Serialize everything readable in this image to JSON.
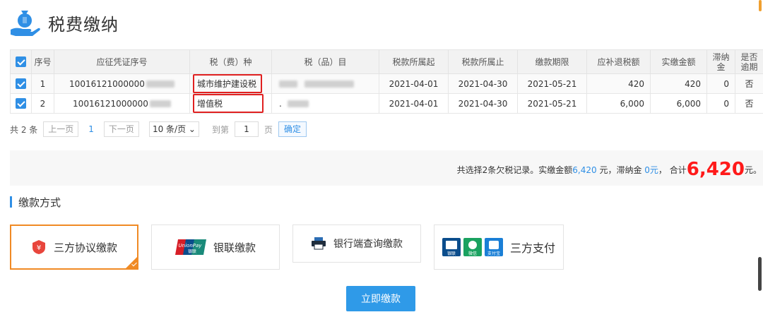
{
  "header": {
    "title": "税费缴纳"
  },
  "table": {
    "columns": [
      "序号",
      "应征凭证序号",
      "税（费）种",
      "税（品）目",
      "税款所属起",
      "税款所属止",
      "缴款期限",
      "应补退税额",
      "实缴金额",
      "滞纳金",
      "是否逾期"
    ],
    "rows": [
      {
        "index": "1",
        "voucher": "10016121000000",
        "tax_type": "城市维护建设税",
        "tax_item": "",
        "start": "2021-04-01",
        "end": "2021-04-30",
        "deadline": "2021-05-21",
        "due": "420",
        "paid": "420",
        "late_fee": "0",
        "overdue": "否"
      },
      {
        "index": "2",
        "voucher": "10016121000000",
        "tax_type": "增值税",
        "tax_item": ".",
        "start": "2021-04-01",
        "end": "2021-04-30",
        "deadline": "2021-05-21",
        "due": "6,000",
        "paid": "6,000",
        "late_fee": "0",
        "overdue": "否"
      }
    ]
  },
  "pager": {
    "total": "共 2 条",
    "prev": "上一页",
    "current": "1",
    "next": "下一页",
    "page_size": "10 条/页",
    "goto_label": "到第",
    "goto_value": "1",
    "page_suffix": "页",
    "confirm": "确定"
  },
  "summary": {
    "prefix": "共选择2条欠税记录。实缴金额",
    "paid_amount": "6,420",
    "mid": " 元，滞纳金 ",
    "late_fee": "0元",
    "total_prefix": "， 合计",
    "total": "6,420",
    "total_suffix": "元。"
  },
  "payment": {
    "section_title": "缴款方式",
    "methods": [
      {
        "label": "三方协议缴款",
        "icon": "agreement-icon"
      },
      {
        "label": "银联缴款",
        "icon": "unionpay-icon",
        "logo_text": "UnionPay",
        "logo_sub": "银联"
      },
      {
        "label": "银行端查询缴款",
        "icon": "printer-icon"
      },
      {
        "label": "三方支付",
        "icon": "third-party-pay-icons",
        "badges": [
          "银联",
          "微信",
          "支付宝"
        ]
      }
    ],
    "submit": "立即缴款"
  },
  "colors": {
    "accent": "#2f8fe5",
    "active_border": "#f08a24",
    "highlight_box": "#e02020",
    "total_red": "#ff1a1a"
  }
}
